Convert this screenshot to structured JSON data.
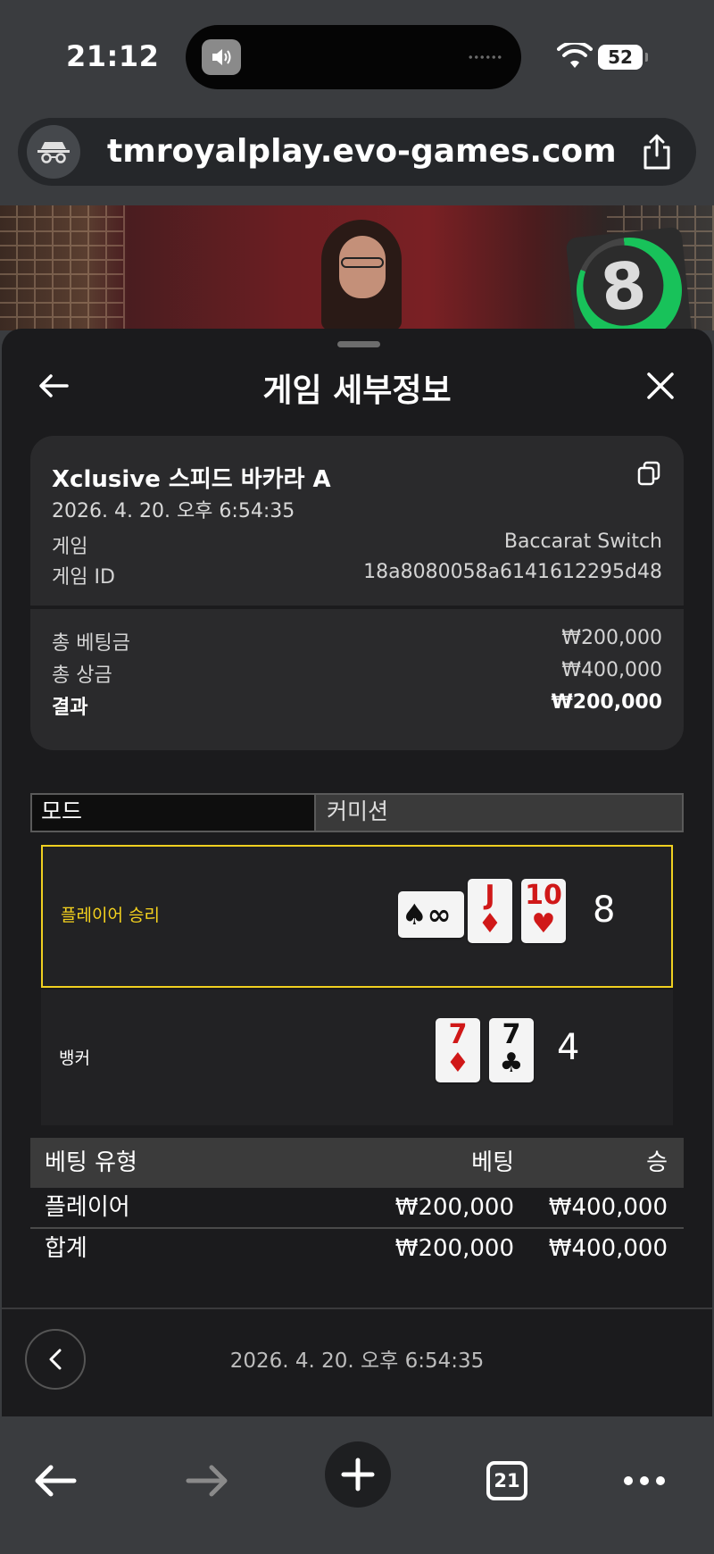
{
  "status_bar": {
    "time": "21:12",
    "battery": "52"
  },
  "browser": {
    "url": "tmroyalplay.evo-games.com",
    "tabs_count": "21"
  },
  "video": {
    "timer_value": "8",
    "timer_progress": 0.83
  },
  "sheet": {
    "title": "게임 세부정보",
    "game_name": "Xclusive 스피드 바카라 A",
    "datetime": "2026. 4. 20. 오후 6:54:35",
    "game_label": "게임",
    "game_value": "Baccarat Switch",
    "game_id_label": "게임 ID",
    "game_id_value": "18a8080058a6141612295d48",
    "total_bet_label": "총 베팅금",
    "total_bet_value": "₩200,000",
    "total_win_label": "총 상금",
    "total_win_value": "₩400,000",
    "result_label": "결과",
    "result_value": "₩200,000"
  },
  "tabs": {
    "mode": "모드",
    "commission": "커미션"
  },
  "hands": {
    "player": {
      "label": "플레이어 승리",
      "score": "8",
      "side_card": {
        "suit": "♠",
        "symbol": "∞"
      },
      "cards": [
        {
          "rank": "J",
          "suit": "♦"
        },
        {
          "rank": "10",
          "suit": "♥"
        }
      ]
    },
    "banker": {
      "label": "뱅커",
      "score": "4",
      "cards": [
        {
          "rank": "7",
          "suit": "♦"
        },
        {
          "rank": "7",
          "suit": "♣"
        }
      ]
    }
  },
  "bets": {
    "headers": [
      "베팅 유형",
      "베팅",
      "승"
    ],
    "rows": [
      [
        "플레이어",
        "₩200,000",
        "₩400,000"
      ],
      [
        "합계",
        "₩200,000",
        "₩400,000"
      ]
    ]
  },
  "footer": {
    "datetime": "2026. 4. 20. 오후 6:54:35"
  },
  "colors": {
    "winner_border": "#f0d020",
    "timer_ring": "#18c25a",
    "sheet_bg": "#1b1b1d",
    "card_red": "#d01818"
  }
}
